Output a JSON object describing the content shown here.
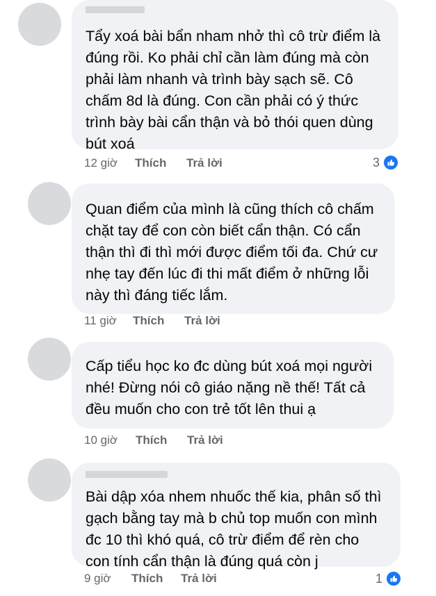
{
  "comments": [
    {
      "author": "",
      "text": "Tẩy xoá bài bẩn nham nhở thì cô trừ điểm là\nđúng rồi. Ko phải chỉ cần làm đúng mà còn\nphải làm nhanh và trình bày sạch sẽ. Cô\nchấm 8d là đúng. Con cần phải có ý thức\ntrình bày bài cẩn thận và bỏ thói quen dùng\nbút xoá",
      "time": "12 giờ",
      "like_label": "Thích",
      "reply_label": "Trả lời",
      "reaction_count": "3",
      "reaction_icon": "like-icon"
    },
    {
      "author": "",
      "text": "Quan điểm của mình là cũng thích cô chấm\nchặt tay để con còn biết cẩn thận. Có cẩn\nthận thì đi thì mới được điểm tối đa. Chứ cư\nnhẹ tay đến lúc đi thi mất điểm ở những lỗi\nnày thì đáng tiếc lắm.",
      "time": "11 giờ",
      "like_label": "Thích",
      "reply_label": "Trả lời"
    },
    {
      "author": "",
      "text": "Cấp tiểu học ko đc dùng bút xoá mọi người\nnhé! Đừng nói cô giáo nặng nề thế! Tất cả\nđều muốn cho con trẻ tốt lên thui ạ",
      "time": "10 giờ",
      "like_label": "Thích",
      "reply_label": "Trả lời"
    },
    {
      "author": "",
      "text": "Bài dập xóa nhem nhuốc thế kia, phân số thì\ngạch bằng tay mà b chủ top muốn con mình\nđc 10 thì khó quá, cô trừ điểm để rèn cho\ncon tính cẩn thận là đúng quá còn j",
      "time": "9 giờ",
      "like_label": "Thích",
      "reply_label": "Trả lời",
      "reaction_count": "1",
      "reaction_icon": "like-icon"
    }
  ],
  "colors": {
    "bubble": "#f0f2f5",
    "text": "#050505",
    "meta": "#65676b",
    "like_blue": "#1877f2",
    "avatar": "#d9dadd"
  }
}
